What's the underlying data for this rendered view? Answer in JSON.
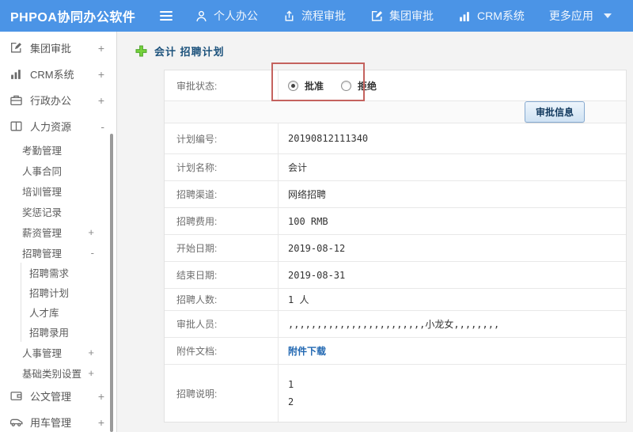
{
  "colors": {
    "topbar": "#4b94e6",
    "highlight_box": "#c4625e",
    "link": "#2268b2",
    "breadcrumb_title": "#1c527c"
  },
  "topbar": {
    "title": "PHPOA协同办公软件",
    "nav": [
      {
        "label": "个人办公",
        "icon": "user-icon"
      },
      {
        "label": "流程审批",
        "icon": "process-icon"
      },
      {
        "label": "集团审批",
        "icon": "edit-square-icon"
      },
      {
        "label": "CRM系统",
        "icon": "bar-chart-icon"
      },
      {
        "label": "更多应用",
        "icon": "caret-down-icon"
      }
    ]
  },
  "sidebar": {
    "items": [
      {
        "label": "集团审批",
        "icon": "edit-square-icon",
        "expand": "+",
        "level": 0
      },
      {
        "label": "CRM系统",
        "icon": "bar-chart-icon",
        "expand": "+",
        "level": 0
      },
      {
        "label": "行政办公",
        "icon": "briefcase-icon",
        "expand": "+",
        "level": 0
      },
      {
        "label": "人力资源",
        "icon": "book-icon",
        "expand": "-",
        "level": 0
      },
      {
        "label": "考勤管理",
        "level": 1
      },
      {
        "label": "人事合同",
        "level": 1
      },
      {
        "label": "培训管理",
        "level": 1
      },
      {
        "label": "奖惩记录",
        "level": 1
      },
      {
        "label": "薪资管理",
        "expand": "+",
        "level": 1
      },
      {
        "label": "招聘管理",
        "expand": "-",
        "level": 1
      },
      {
        "label": "招聘需求",
        "level": 2
      },
      {
        "label": "招聘计划",
        "level": 2
      },
      {
        "label": "人才库",
        "level": 2
      },
      {
        "label": "招聘录用",
        "level": 2
      },
      {
        "label": "人事管理",
        "expand": "+",
        "level": 1
      },
      {
        "label": "基础类别设置",
        "expand": "+",
        "level": 1
      },
      {
        "label": "公文管理",
        "icon": "document-icon",
        "expand": "+",
        "level": 0
      },
      {
        "label": "用车管理",
        "icon": "car-icon",
        "expand": "+",
        "level": 0
      }
    ]
  },
  "breadcrumb": {
    "title": "会计 招聘计划"
  },
  "form": {
    "status_label": "审批状态:",
    "radio_approve": "批准",
    "radio_reject": "拒绝",
    "approve_button": "审批信息",
    "rows": [
      {
        "label": "计划编号:",
        "value": "20190812111340"
      },
      {
        "label": "计划名称:",
        "value": "会计"
      },
      {
        "label": "招聘渠道:",
        "value": "网络招聘"
      },
      {
        "label": "招聘费用:",
        "value": "100 RMB"
      },
      {
        "label": "开始日期:",
        "value": "2019-08-12"
      },
      {
        "label": "结束日期:",
        "value": "2019-08-31"
      },
      {
        "label": "招聘人数:",
        "value": "1 人"
      },
      {
        "label": "审批人员:",
        "value": ",,,,,,,,,,,,,,,,,,,,,,,,小龙女,,,,,,,,"
      },
      {
        "label": "附件文档:",
        "value": "附件下载"
      },
      {
        "label": "招聘说明:",
        "line1": "1",
        "line2": "2"
      }
    ]
  }
}
